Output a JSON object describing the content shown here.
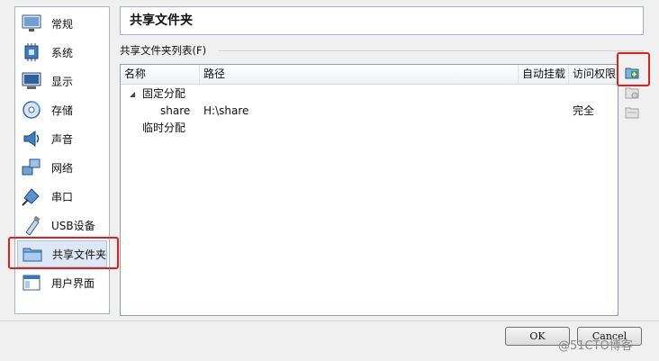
{
  "sidebar": {
    "items": [
      {
        "label": "常规",
        "icon": "monitor-icon"
      },
      {
        "label": "系统",
        "icon": "chip-icon"
      },
      {
        "label": "显示",
        "icon": "display-icon"
      },
      {
        "label": "存储",
        "icon": "disk-icon"
      },
      {
        "label": "声音",
        "icon": "speaker-icon"
      },
      {
        "label": "网络",
        "icon": "network-icon"
      },
      {
        "label": "串口",
        "icon": "serial-icon"
      },
      {
        "label": "USB设备",
        "icon": "usb-icon"
      },
      {
        "label": "共享文件夹",
        "icon": "folder-icon"
      },
      {
        "label": "用户界面",
        "icon": "window-icon"
      }
    ],
    "selected_index": 8
  },
  "page": {
    "title": "共享文件夹"
  },
  "group": {
    "legend": "共享文件夹列表(F)"
  },
  "table": {
    "columns": [
      "名称",
      "路径",
      "自动挂载",
      "访问权限"
    ],
    "rows": [
      {
        "name": "固定分配",
        "path": "",
        "automount": "",
        "access": ""
      },
      {
        "name": "share",
        "path": "H:\\share",
        "automount": "",
        "access": "完全"
      },
      {
        "name": "临时分配",
        "path": "",
        "automount": "",
        "access": ""
      }
    ]
  },
  "toolbar": {
    "items": [
      {
        "icon": "add-folder-icon"
      },
      {
        "icon": "edit-folder-icon"
      },
      {
        "icon": "remove-folder-icon"
      }
    ]
  },
  "buttons": {
    "ok": "OK",
    "cancel": "Cancel"
  },
  "watermark": "@51CTO博客",
  "colors": {
    "highlight_box": "#e0201a",
    "selection": "#dde8f5"
  }
}
